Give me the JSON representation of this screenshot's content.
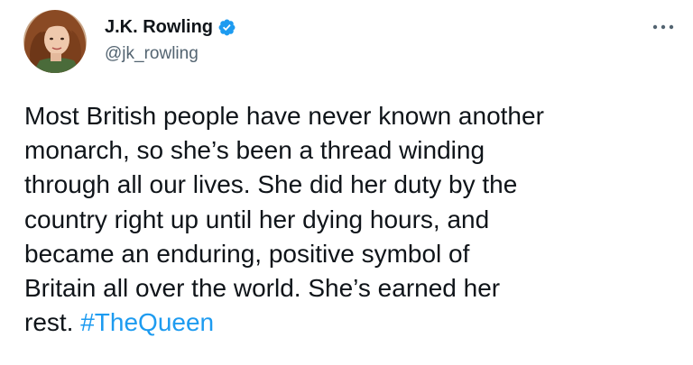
{
  "author": {
    "display_name": "J.K. Rowling",
    "handle": "@jk_rowling",
    "verified": true,
    "avatar_icon": "profile-photo"
  },
  "menu": {
    "icon": "more-horizontal-icon"
  },
  "tweet": {
    "lines": [
      "Most British people have never known another",
      "monarch, so she’s been a thread winding",
      "through all our lives. She did her duty by the",
      "country right up until her dying hours, and",
      "became an enduring, positive symbol of",
      "Britain all over the world. She’s earned her"
    ],
    "last_line_text": "rest. ",
    "hashtag": "#TheQueen"
  },
  "colors": {
    "text": "#0f1419",
    "secondary_text": "#536471",
    "accent": "#1d9bf0",
    "background": "#ffffff"
  }
}
